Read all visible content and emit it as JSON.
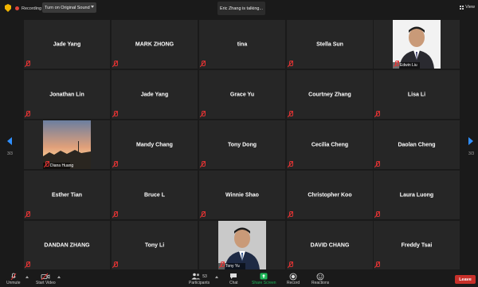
{
  "topbar": {
    "recording_label": "Recording",
    "original_sound_label": "Turn on Original Sound",
    "talking_text": "Eric Zhang is talking...",
    "view_label": "View"
  },
  "pager": {
    "left": "3/3",
    "right": "3/3"
  },
  "tiles": [
    [
      "Jade Yang",
      "MARK ZHONG",
      "tina",
      "Stella Sun",
      "Edwin Liu"
    ],
    [
      "Jonathan Lin",
      "Jade Yang",
      "Grace Yu",
      "Courtney Zhang",
      "Lisa Li"
    ],
    [
      "Diana Huang",
      "Mandy Chang",
      "Tony Dong",
      "Cecilia Cheng",
      "Daolan Cheng"
    ],
    [
      "Esther Tian",
      "Bruce L",
      "Winnie Shao",
      "Christopher Koo",
      "Laura Luong"
    ],
    [
      "DANDAN ZHANG",
      "Tony Li",
      "Tony Yu",
      "DAVID CHANG",
      "Freddy Tsai"
    ]
  ],
  "toolbar": {
    "unmute": "Unmute",
    "start_video": "Start Video",
    "participants": "Participants",
    "participants_count": "53",
    "chat": "Chat",
    "share_screen": "Share Screen",
    "record": "Record",
    "reactions": "Reactions",
    "leave": "Leave"
  },
  "colors": {
    "accent": "#2f8fff",
    "leave": "#c8302a",
    "share": "#1fb85a",
    "recording": "#e0453a"
  }
}
